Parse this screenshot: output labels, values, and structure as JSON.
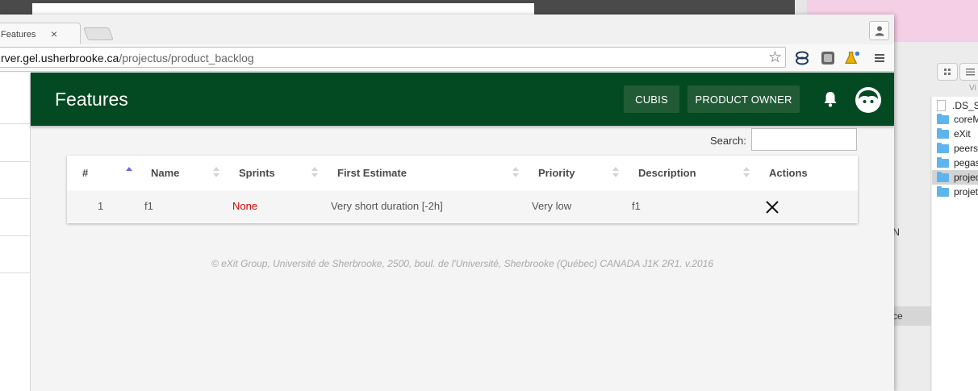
{
  "browser": {
    "tab_title": "Features",
    "tab_close": "×",
    "url_host": "rver.gel.usherbrooke.ca",
    "url_path": "/projectus/product_backlog",
    "bookmark_icon": "star-icon"
  },
  "app": {
    "title": "Features",
    "buttons": [
      "CUBIS",
      "PRODUCT OWNER"
    ],
    "notification_icon": "bell-icon",
    "avatar_icon": "face-icon",
    "primary_color": "#034a22"
  },
  "search": {
    "label": "Search:",
    "value": ""
  },
  "table": {
    "columns": [
      "#",
      "Name",
      "Sprints",
      "First Estimate",
      "Priority",
      "Description",
      "Actions"
    ],
    "sorted_column": "#",
    "rows": [
      {
        "id": "1",
        "name": "f1",
        "sprints": "None",
        "first_estimate": "Very short duration [-2h]",
        "priority": "Very low",
        "description": "f1",
        "action_icon": "close-icon"
      }
    ]
  },
  "footer": "© eXit Group, Université de Sherbrooke, 2500, boul. de l'Université, Sherbrooke (Québec) CANADA J1K 2R1. v.2016",
  "finder": {
    "view_label": "Vi",
    "files": [
      ".DS_S",
      "coreM",
      "eXit",
      "peers",
      "pegas",
      "projec",
      "projet"
    ],
    "selected_file": "projec",
    "sidebar_fragments": [
      "'N",
      "ce"
    ]
  }
}
